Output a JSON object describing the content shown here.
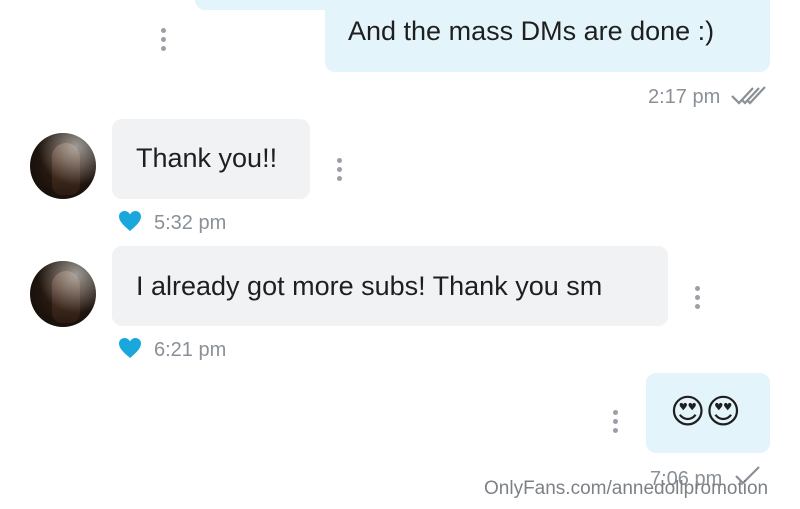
{
  "messages": [
    {
      "direction": "outgoing",
      "text": "And the mass DMs are done :)",
      "time": "2:17 pm",
      "status": "double-check-icon"
    },
    {
      "direction": "incoming",
      "text": "Thank you!!",
      "time": "5:32 pm",
      "reaction": "heart-icon"
    },
    {
      "direction": "incoming",
      "text": "I already got more subs! Thank you sm",
      "time": "6:21 pm",
      "reaction": "heart-icon"
    },
    {
      "direction": "outgoing",
      "text": "😍😍",
      "time": "7:06 pm",
      "status": "single-check-icon"
    }
  ],
  "watermark": "OnlyFans.com/annedollpromotion",
  "colors": {
    "outgoing_bubble": "#e3f5fb",
    "incoming_bubble": "#f0f2f4",
    "heart": "#1aa7dc",
    "time_text": "#8a9097"
  }
}
